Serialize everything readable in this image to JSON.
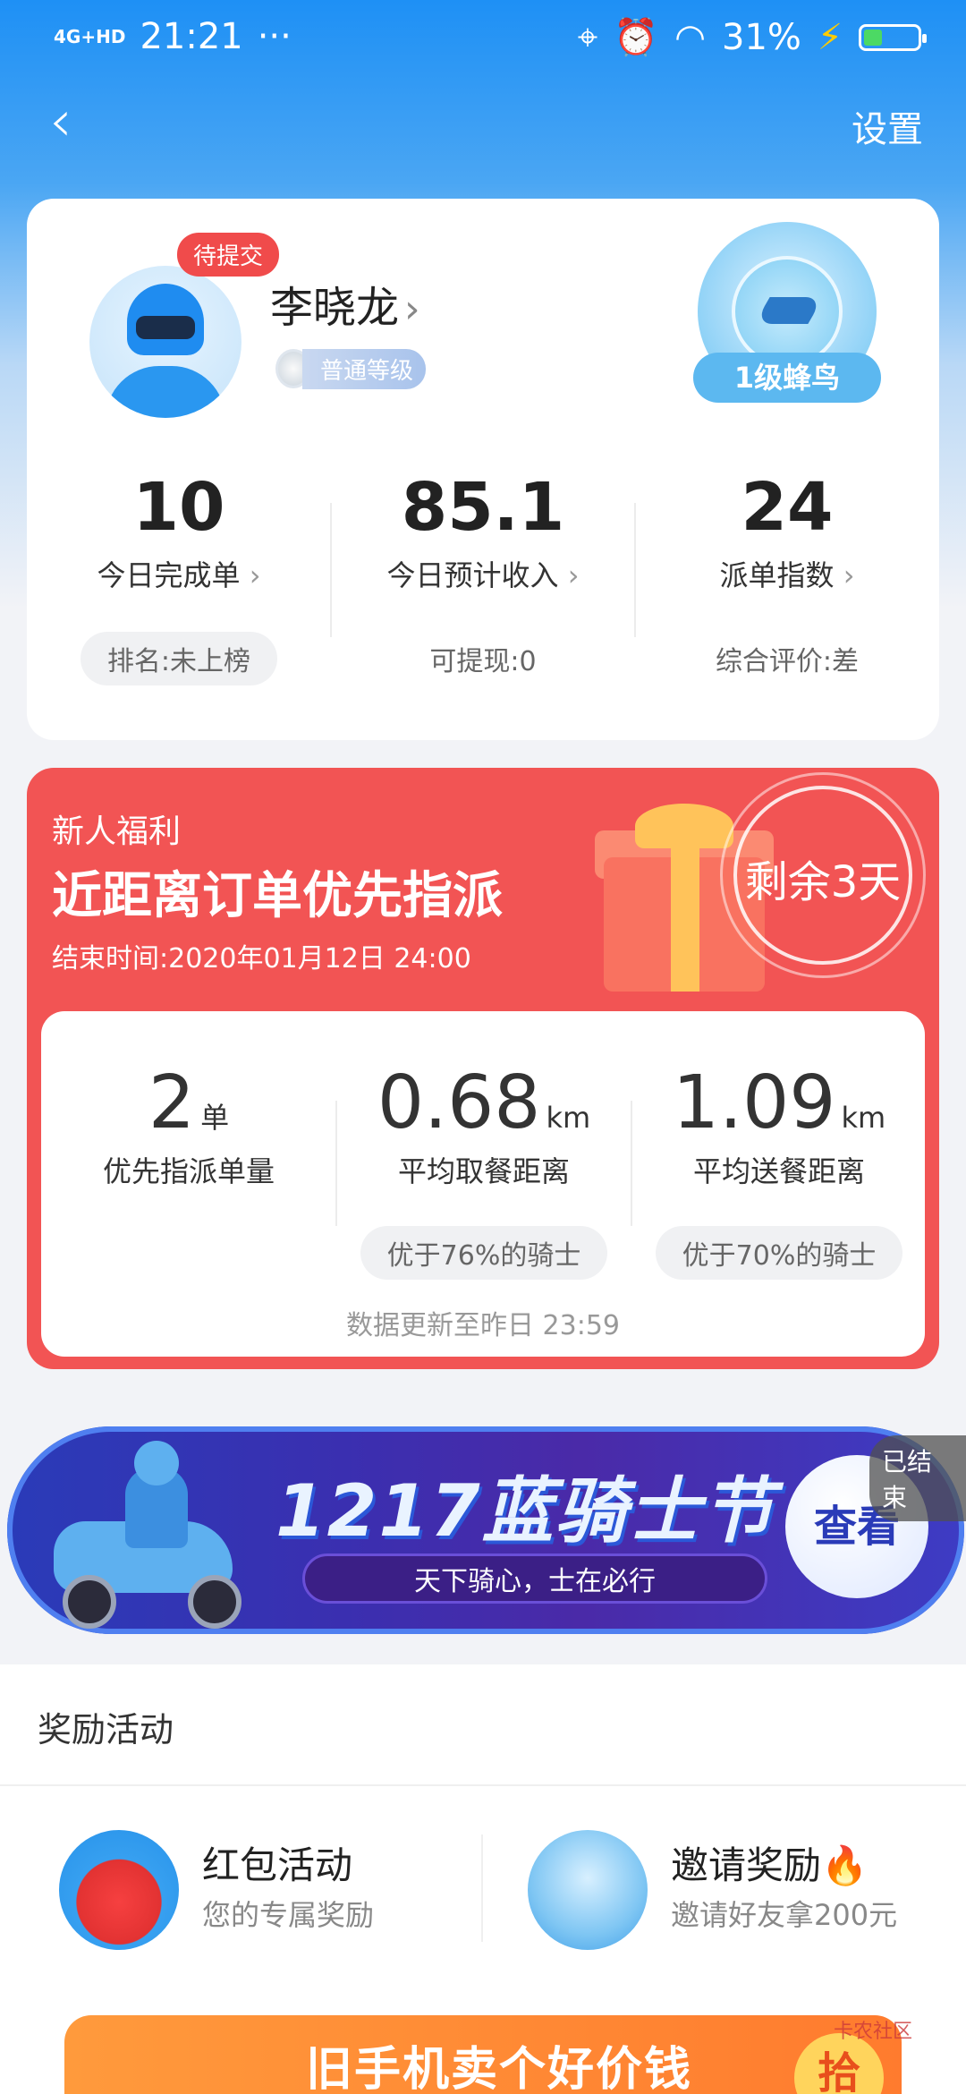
{
  "status_bar": {
    "network": "4G+HD",
    "time": "21:21",
    "dots": "···",
    "battery": "31%"
  },
  "nav": {
    "back_icon": "chevron-left-icon",
    "settings": "设置"
  },
  "profile": {
    "pending_tag": "待提交",
    "name": "李晓龙",
    "name_chevron": "›",
    "level": "普通等级",
    "badge_label": "1级蜂鸟",
    "stats": [
      {
        "value": "10",
        "label": "今日完成单",
        "sub": "排名:未上榜"
      },
      {
        "value": "85.1",
        "label": "今日预计收入",
        "sub": "可提现:0"
      },
      {
        "value": "24",
        "label": "派单指数",
        "sub": "综合评价:差"
      }
    ],
    "chevron": "›"
  },
  "benefit": {
    "tag": "新人福利",
    "title": "近距离订单优先指派",
    "end_time": "结束时间:2020年01月12日 24:00",
    "remaining": "剩余3天",
    "metrics": [
      {
        "value": "2",
        "unit": "单",
        "label": "优先指派单量",
        "pill": ""
      },
      {
        "value": "0.68",
        "unit": "km",
        "label": "平均取餐距离",
        "pill": "优于76%的骑士"
      },
      {
        "value": "1.09",
        "unit": "km",
        "label": "平均送餐距离",
        "pill": "优于70%的骑士"
      }
    ],
    "update_note": "数据更新至昨日 23:59"
  },
  "banner": {
    "title": "1217蓝骑士节",
    "subtitle": "天下骑心，士在必行",
    "view_button": "查看",
    "ended_tag": "已结束"
  },
  "rewards": {
    "section_title": "奖励活动",
    "items": [
      {
        "name": "红包活动",
        "desc": "您的专属奖励",
        "icon": "red-envelope-icon"
      },
      {
        "name": "邀请奖励",
        "desc": "邀请好友拿200元",
        "icon": "rider-avatar-icon",
        "hot": "🔥"
      }
    ]
  },
  "promo": {
    "text": "旧手机卖个好价钱",
    "coin": "拾"
  },
  "watermark": "卡农社区"
}
